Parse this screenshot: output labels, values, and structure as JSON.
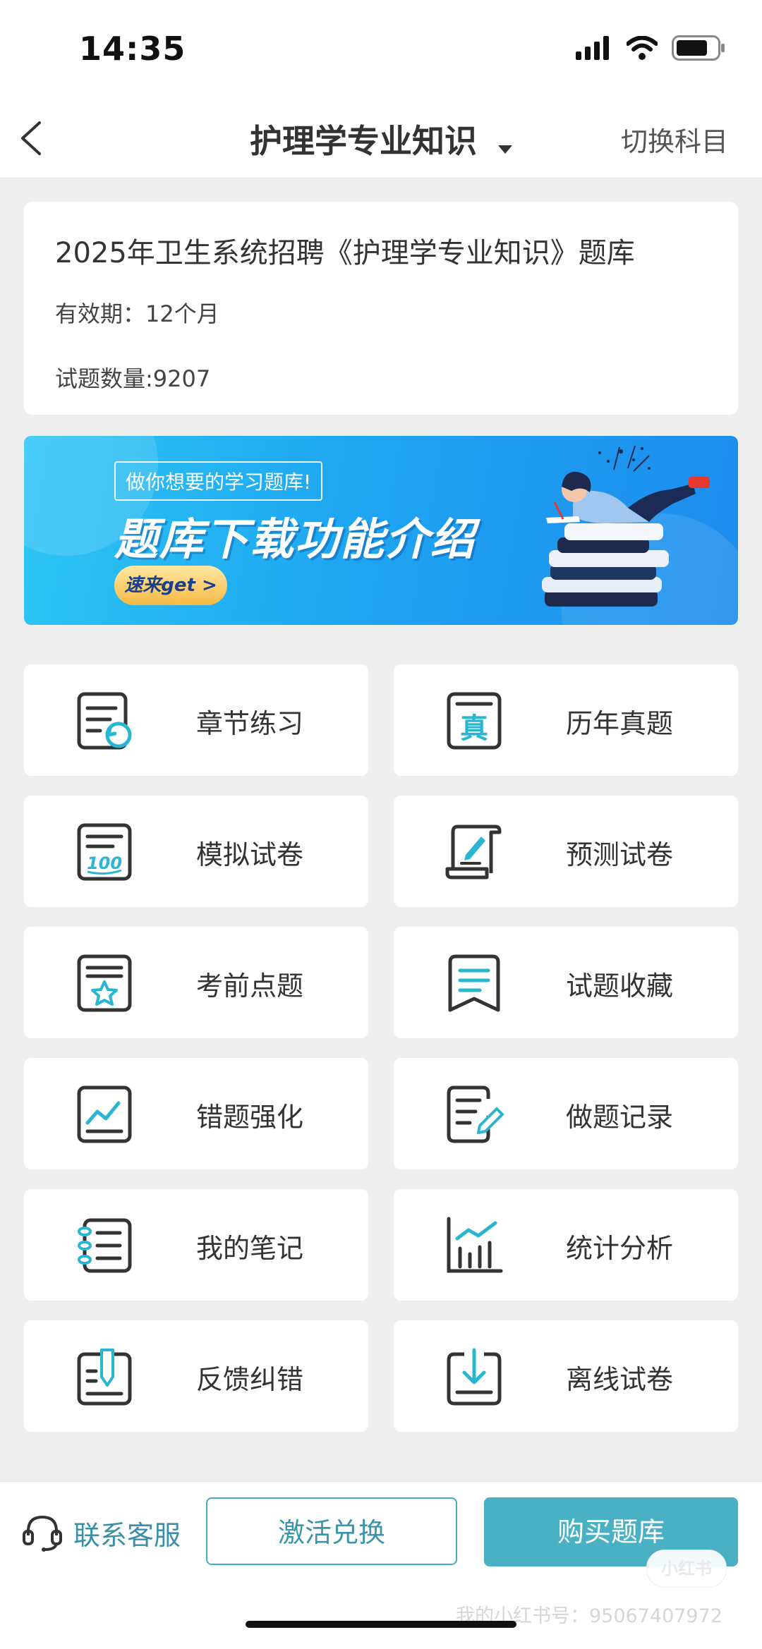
{
  "status": {
    "time": "14:35"
  },
  "nav": {
    "title": "护理学专业知识",
    "switch": "切换科目"
  },
  "info": {
    "title": "2025年卫生系统招聘《护理学专业知识》题库",
    "validity": "有效期：12个月",
    "count": "试题数量:9207"
  },
  "banner": {
    "tag": "做你想要的学习题库!",
    "heading": "题库下载功能介绍",
    "cta": "速来get >"
  },
  "menu": [
    {
      "label": "章节练习",
      "icon": "chapter-practice-icon"
    },
    {
      "label": "历年真题",
      "icon": "past-exams-icon"
    },
    {
      "label": "模拟试卷",
      "icon": "mock-exam-icon"
    },
    {
      "label": "预测试卷",
      "icon": "predicted-exam-icon"
    },
    {
      "label": "考前点题",
      "icon": "key-points-icon"
    },
    {
      "label": "试题收藏",
      "icon": "favorites-icon"
    },
    {
      "label": "错题强化",
      "icon": "wrong-answers-icon"
    },
    {
      "label": "做题记录",
      "icon": "practice-history-icon"
    },
    {
      "label": "我的笔记",
      "icon": "notes-icon"
    },
    {
      "label": "统计分析",
      "icon": "statistics-icon"
    },
    {
      "label": "反馈纠错",
      "icon": "feedback-icon"
    },
    {
      "label": "离线试卷",
      "icon": "offline-download-icon"
    }
  ],
  "bottom": {
    "service": "联系客服",
    "activate": "激活兑换",
    "buy": "购买题库"
  },
  "watermark": {
    "logo": "小红书",
    "id_text": "我的小红书号：9506740​7972"
  },
  "colors": {
    "accent": "#4ab0c4",
    "icon_stroke": "#333333",
    "icon_accent": "#29b6d3"
  }
}
